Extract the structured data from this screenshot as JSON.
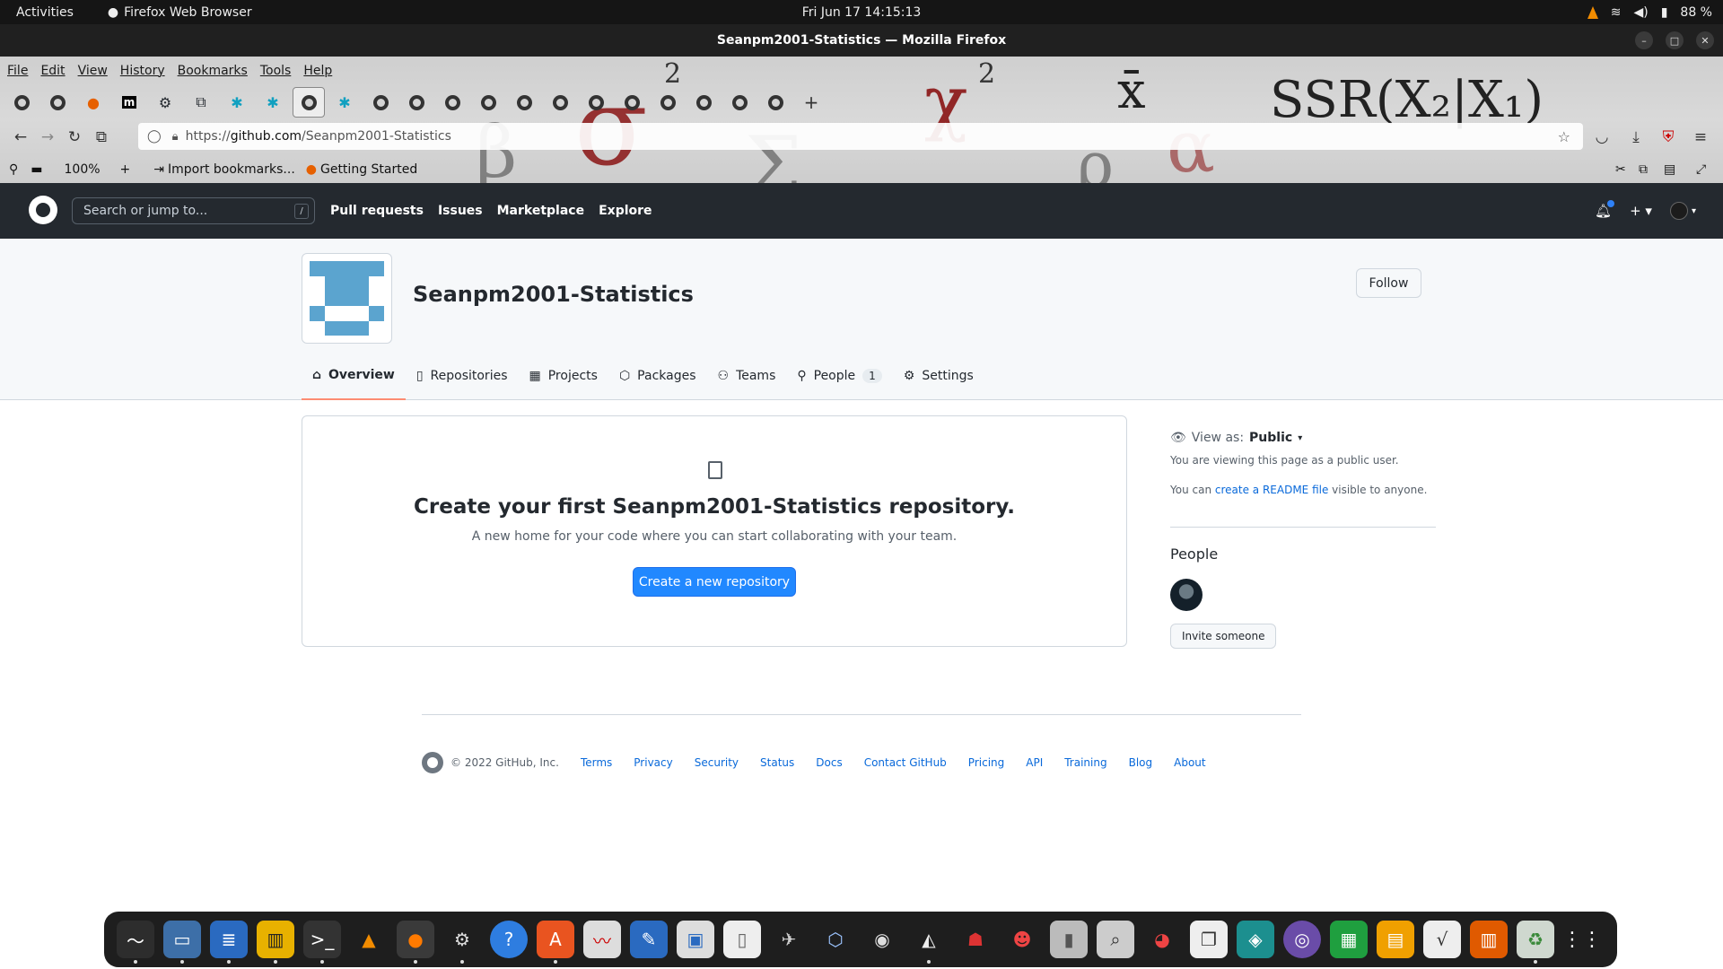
{
  "system": {
    "activities": "Activities",
    "app_name": "Firefox Web Browser",
    "clock": "Fri Jun 17  14:15:13",
    "battery": "88 %"
  },
  "window": {
    "title": "Seanpm2001-Statistics — Mozilla Firefox"
  },
  "chrome": {
    "menu": [
      "File",
      "Edit",
      "View",
      "History",
      "Bookmarks",
      "Tools",
      "Help"
    ],
    "url_scheme": "https://",
    "url_host": "github.com",
    "url_path": "/Seanpm2001-Statistics",
    "zoom": "100%",
    "bookmarks": [
      "Import bookmarks...",
      "Getting Started"
    ],
    "theme_glyphs": [
      "σ",
      "2",
      "β",
      "Σ",
      "χ",
      "2",
      "x̄",
      "ρ",
      "α",
      "SSR(X₂|X₁)"
    ]
  },
  "github": {
    "search_placeholder": "Search or jump to...",
    "search_key": "/",
    "nav": [
      "Pull requests",
      "Issues",
      "Marketplace",
      "Explore"
    ],
    "plus": "+ ▾"
  },
  "org": {
    "name": "Seanpm2001-Statistics",
    "follow": "Follow",
    "tabs": [
      {
        "label": "Overview",
        "icon": "home-icon"
      },
      {
        "label": "Repositories",
        "icon": "repo-icon"
      },
      {
        "label": "Projects",
        "icon": "project-icon"
      },
      {
        "label": "Packages",
        "icon": "package-icon"
      },
      {
        "label": "Teams",
        "icon": "people-icon"
      },
      {
        "label": "People",
        "icon": "person-icon",
        "count": "1"
      },
      {
        "label": "Settings",
        "icon": "gear-icon"
      }
    ]
  },
  "blankslate": {
    "heading": "Create your first Seanpm2001-Statistics repository.",
    "text": "A new home for your code where you can start collaborating with your team.",
    "button": "Create a new repository"
  },
  "sidebar": {
    "view_as_label": "View as:",
    "view_as_value": "Public",
    "viewing_note": "You are viewing this page as a public user.",
    "readme_prefix": "You can ",
    "readme_link": "create a README file",
    "readme_suffix": " visible to anyone.",
    "people_heading": "People",
    "invite": "Invite someone"
  },
  "footer": {
    "copyright": "© 2022 GitHub, Inc.",
    "links": [
      "Terms",
      "Privacy",
      "Security",
      "Status",
      "Docs",
      "Contact GitHub",
      "Pricing",
      "API",
      "Training",
      "Blog",
      "About"
    ]
  },
  "colors": {
    "accent": "#2188ff",
    "tab_underline": "#fd8c73",
    "header_bg": "#24292f",
    "avatar_blue": "#5ba4cf"
  }
}
